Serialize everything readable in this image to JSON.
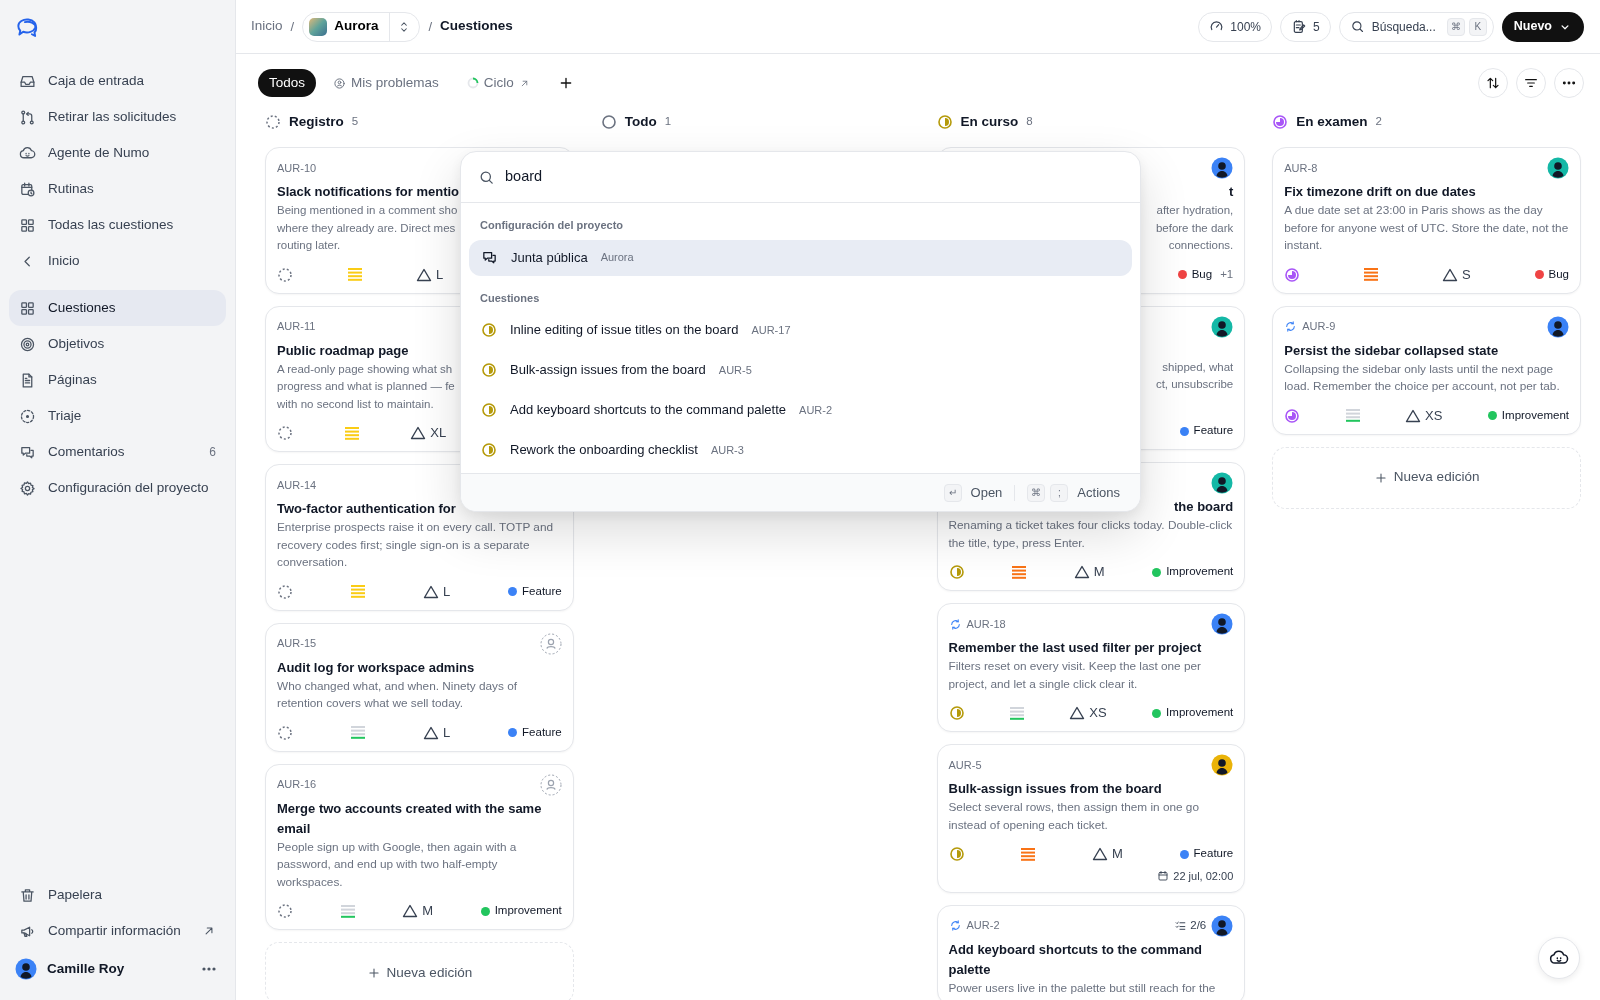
{
  "sidebar": {
    "workspace_items": [
      {
        "label": "Caja de entrada",
        "selected": false
      },
      {
        "label": "Retirar las solicitudes",
        "selected": false
      },
      {
        "label": "Agente de Numo",
        "selected": false
      },
      {
        "label": "Rutinas",
        "selected": false
      },
      {
        "label": "Todas las cuestiones",
        "selected": false
      },
      {
        "label": "Inicio",
        "selected": false
      }
    ],
    "project_items": [
      {
        "label": "Cuestiones",
        "selected": true
      },
      {
        "label": "Objetivos",
        "selected": false
      },
      {
        "label": "Páginas",
        "selected": false
      },
      {
        "label": "Triaje",
        "selected": false
      },
      {
        "label": "Comentarios",
        "selected": false,
        "badge": "6"
      },
      {
        "label": "Configuración del proyecto",
        "selected": false
      }
    ],
    "bottom_items": [
      {
        "label": "Papelera",
        "selected": false,
        "external": false
      },
      {
        "label": "Compartir información",
        "selected": false,
        "external": true
      }
    ],
    "user": {
      "name": "Camille Roy",
      "color": "#3b82f6"
    }
  },
  "topbar": {
    "breadcrumb": "Inicio",
    "separators": [
      "/",
      "/"
    ],
    "project": "Aurora",
    "page": "Cuestiones",
    "zoom": "100%",
    "notes_count": "5",
    "search_label": "Búsqueda...",
    "search_keys": [
      "⌘",
      "K"
    ],
    "new_button": "Nuevo"
  },
  "tabs": [
    {
      "label": "Todos",
      "selected": true,
      "external": false
    },
    {
      "label": "Mis problemas",
      "selected": false,
      "external": false
    },
    {
      "label": "Ciclo",
      "selected": false,
      "external": true
    }
  ],
  "columns": [
    {
      "name": "Registro",
      "count": "5",
      "status": {
        "kind": "backlog"
      },
      "add_button": "Nueva edición",
      "cards": [
        {
          "in_cycle": false,
          "id": "AUR-10",
          "title": "Slack notifications for mentio",
          "description_lines": [
            "Being mentioned in a comment sho",
            "where they already are. Direct mes",
            "routing later."
          ],
          "status": {
            "kind": "backlog"
          },
          "priority": {
            "kind": "medium"
          },
          "size": "L"
        },
        {
          "in_cycle": false,
          "id": "AUR-11",
          "title": "Public roadmap page",
          "description_lines": [
            "A read-only page showing what sh",
            "progress and what is planned — fe",
            "with no second list to maintain."
          ],
          "status": {
            "kind": "backlog"
          },
          "priority": {
            "kind": "medium"
          },
          "size": "XL"
        },
        {
          "in_cycle": false,
          "id": "AUR-14",
          "title": "Two-factor authentication for",
          "description": "Enterprise prospects raise it on every call. TOTP and recovery codes first; single sign-on is a separate conversation.",
          "status": {
            "kind": "backlog"
          },
          "priority": {
            "kind": "medium"
          },
          "size": "L",
          "label": {
            "text": "Feature",
            "color": "#3b82f6"
          }
        },
        {
          "in_cycle": false,
          "id": "AUR-15",
          "assignee": {
            "kind": "none"
          },
          "title": "Audit log for workspace admins",
          "description": "Who changed what, and when. Ninety days of retention covers what we sell today.",
          "status": {
            "kind": "backlog"
          },
          "priority": {
            "kind": "low"
          },
          "size": "L",
          "label": {
            "text": "Feature",
            "color": "#3b82f6"
          }
        },
        {
          "in_cycle": false,
          "id": "AUR-16",
          "assignee": {
            "kind": "none"
          },
          "title": "Merge two accounts created with the same email",
          "description": "People sign up with Google, then again with a password, and end up with two half-empty workspaces.",
          "status": {
            "kind": "backlog"
          },
          "priority": {
            "kind": "low"
          },
          "size": "M",
          "label": {
            "text": "Improvement",
            "color": "#22c55e"
          }
        }
      ]
    },
    {
      "name": "Todo",
      "count": "1",
      "status": {
        "kind": "todo"
      }
    },
    {
      "name": "En curso",
      "count": "8",
      "status": {
        "kind": "in_progress"
      },
      "cards": [
        {
          "right_aligned": true,
          "in_cycle": false,
          "assignee": {
            "kind": "person",
            "color": "#3b82f6"
          },
          "title": "t",
          "description_lines": [
            "after hydration,",
            "before the dark",
            "connections."
          ],
          "label": {
            "text": "Bug",
            "color": "#ef4444"
          },
          "extra_labels": "+1"
        },
        {
          "right_aligned": true,
          "in_cycle": false,
          "assignee": {
            "kind": "person",
            "color": "#14b8a6"
          },
          "description_lines": [
            "shipped, what",
            "ct, unsubscribe"
          ],
          "label": {
            "text": "Feature",
            "color": "#3b82f6"
          }
        },
        {
          "right_aligned": true,
          "in_cycle": false,
          "assignee": {
            "kind": "person",
            "color": "#14b8a6"
          },
          "title": "the board",
          "description": "Renaming a ticket takes four clicks today. Double-click the title, type, press Enter.",
          "status": {
            "kind": "in_progress"
          },
          "priority": {
            "kind": "high"
          },
          "size": "M",
          "label": {
            "text": "Improvement",
            "color": "#22c55e"
          }
        },
        {
          "in_cycle": true,
          "id": "AUR-18",
          "assignee": {
            "kind": "person",
            "color": "#3b82f6"
          },
          "title": "Remember the last used filter per project",
          "description": "Filters reset on every visit. Keep the last one per project, and let a single click clear it.",
          "status": {
            "kind": "in_progress"
          },
          "priority": {
            "kind": "low"
          },
          "size": "XS",
          "label": {
            "text": "Improvement",
            "color": "#22c55e"
          }
        },
        {
          "in_cycle": false,
          "id": "AUR-5",
          "assignee": {
            "kind": "person",
            "color": "#eab308"
          },
          "title": "Bulk-assign issues from the board",
          "description": "Select several rows, then assign them in one go instead of opening each ticket.",
          "status": {
            "kind": "in_progress"
          },
          "priority": {
            "kind": "high"
          },
          "size": "M",
          "label": {
            "text": "Feature",
            "color": "#3b82f6"
          },
          "due": "22 jul, 02:00"
        },
        {
          "in_cycle": true,
          "id": "AUR-2",
          "checklist": "2/6",
          "assignee": {
            "kind": "person",
            "color": "#3b82f6"
          },
          "title": "Add keyboard shortcuts to the command palette",
          "description": "Power users live in the palette but still reach for the"
        }
      ]
    },
    {
      "name": "En examen",
      "count": "2",
      "status": {
        "kind": "in_review"
      },
      "add_button": "Nueva edición",
      "cards": [
        {
          "in_cycle": false,
          "id": "AUR-8",
          "assignee": {
            "kind": "person",
            "color": "#14b8a6"
          },
          "title": "Fix timezone drift on due dates",
          "description": "A due date set at 23:00 in Paris shows as the day before for anyone west of UTC. Store the date, not the instant.",
          "status": {
            "kind": "in_review"
          },
          "priority": {
            "kind": "high"
          },
          "size": "S",
          "label": {
            "text": "Bug",
            "color": "#ef4444"
          }
        },
        {
          "in_cycle": true,
          "id": "AUR-9",
          "assignee": {
            "kind": "person",
            "color": "#3b82f6"
          },
          "title": "Persist the sidebar collapsed state",
          "description": "Collapsing the sidebar only lasts until the next page load. Remember the choice per account, not per tab.",
          "status": {
            "kind": "in_review"
          },
          "priority": {
            "kind": "low"
          },
          "size": "XS",
          "label": {
            "text": "Improvement",
            "color": "#22c55e"
          }
        }
      ]
    }
  ],
  "palette": {
    "query": "board",
    "sections": [
      {
        "title": "Configuración del proyecto",
        "items": [
          {
            "kind": "page",
            "label": "Junta pública",
            "meta": "Aurora",
            "selected": true
          }
        ]
      },
      {
        "title": "Cuestiones",
        "items": [
          {
            "kind": "issue",
            "status": {
              "kind": "in_progress"
            },
            "label": "Inline editing of issue titles on the board",
            "meta": "AUR-17",
            "selected": false
          },
          {
            "kind": "issue",
            "status": {
              "kind": "in_progress"
            },
            "label": "Bulk-assign issues from the board",
            "meta": "AUR-5",
            "selected": false
          },
          {
            "kind": "issue",
            "status": {
              "kind": "in_progress"
            },
            "label": "Add keyboard shortcuts to the command palette",
            "meta": "AUR-2",
            "selected": false
          },
          {
            "kind": "issue",
            "status": {
              "kind": "in_progress"
            },
            "label": "Rework the onboarding checklist",
            "meta": "AUR-3",
            "selected": false
          }
        ]
      }
    ],
    "hints": [
      {
        "keys": [
          "↵"
        ],
        "label": "Open"
      },
      {
        "keys": [
          "⌘",
          ";"
        ],
        "label": "Actions"
      }
    ]
  }
}
